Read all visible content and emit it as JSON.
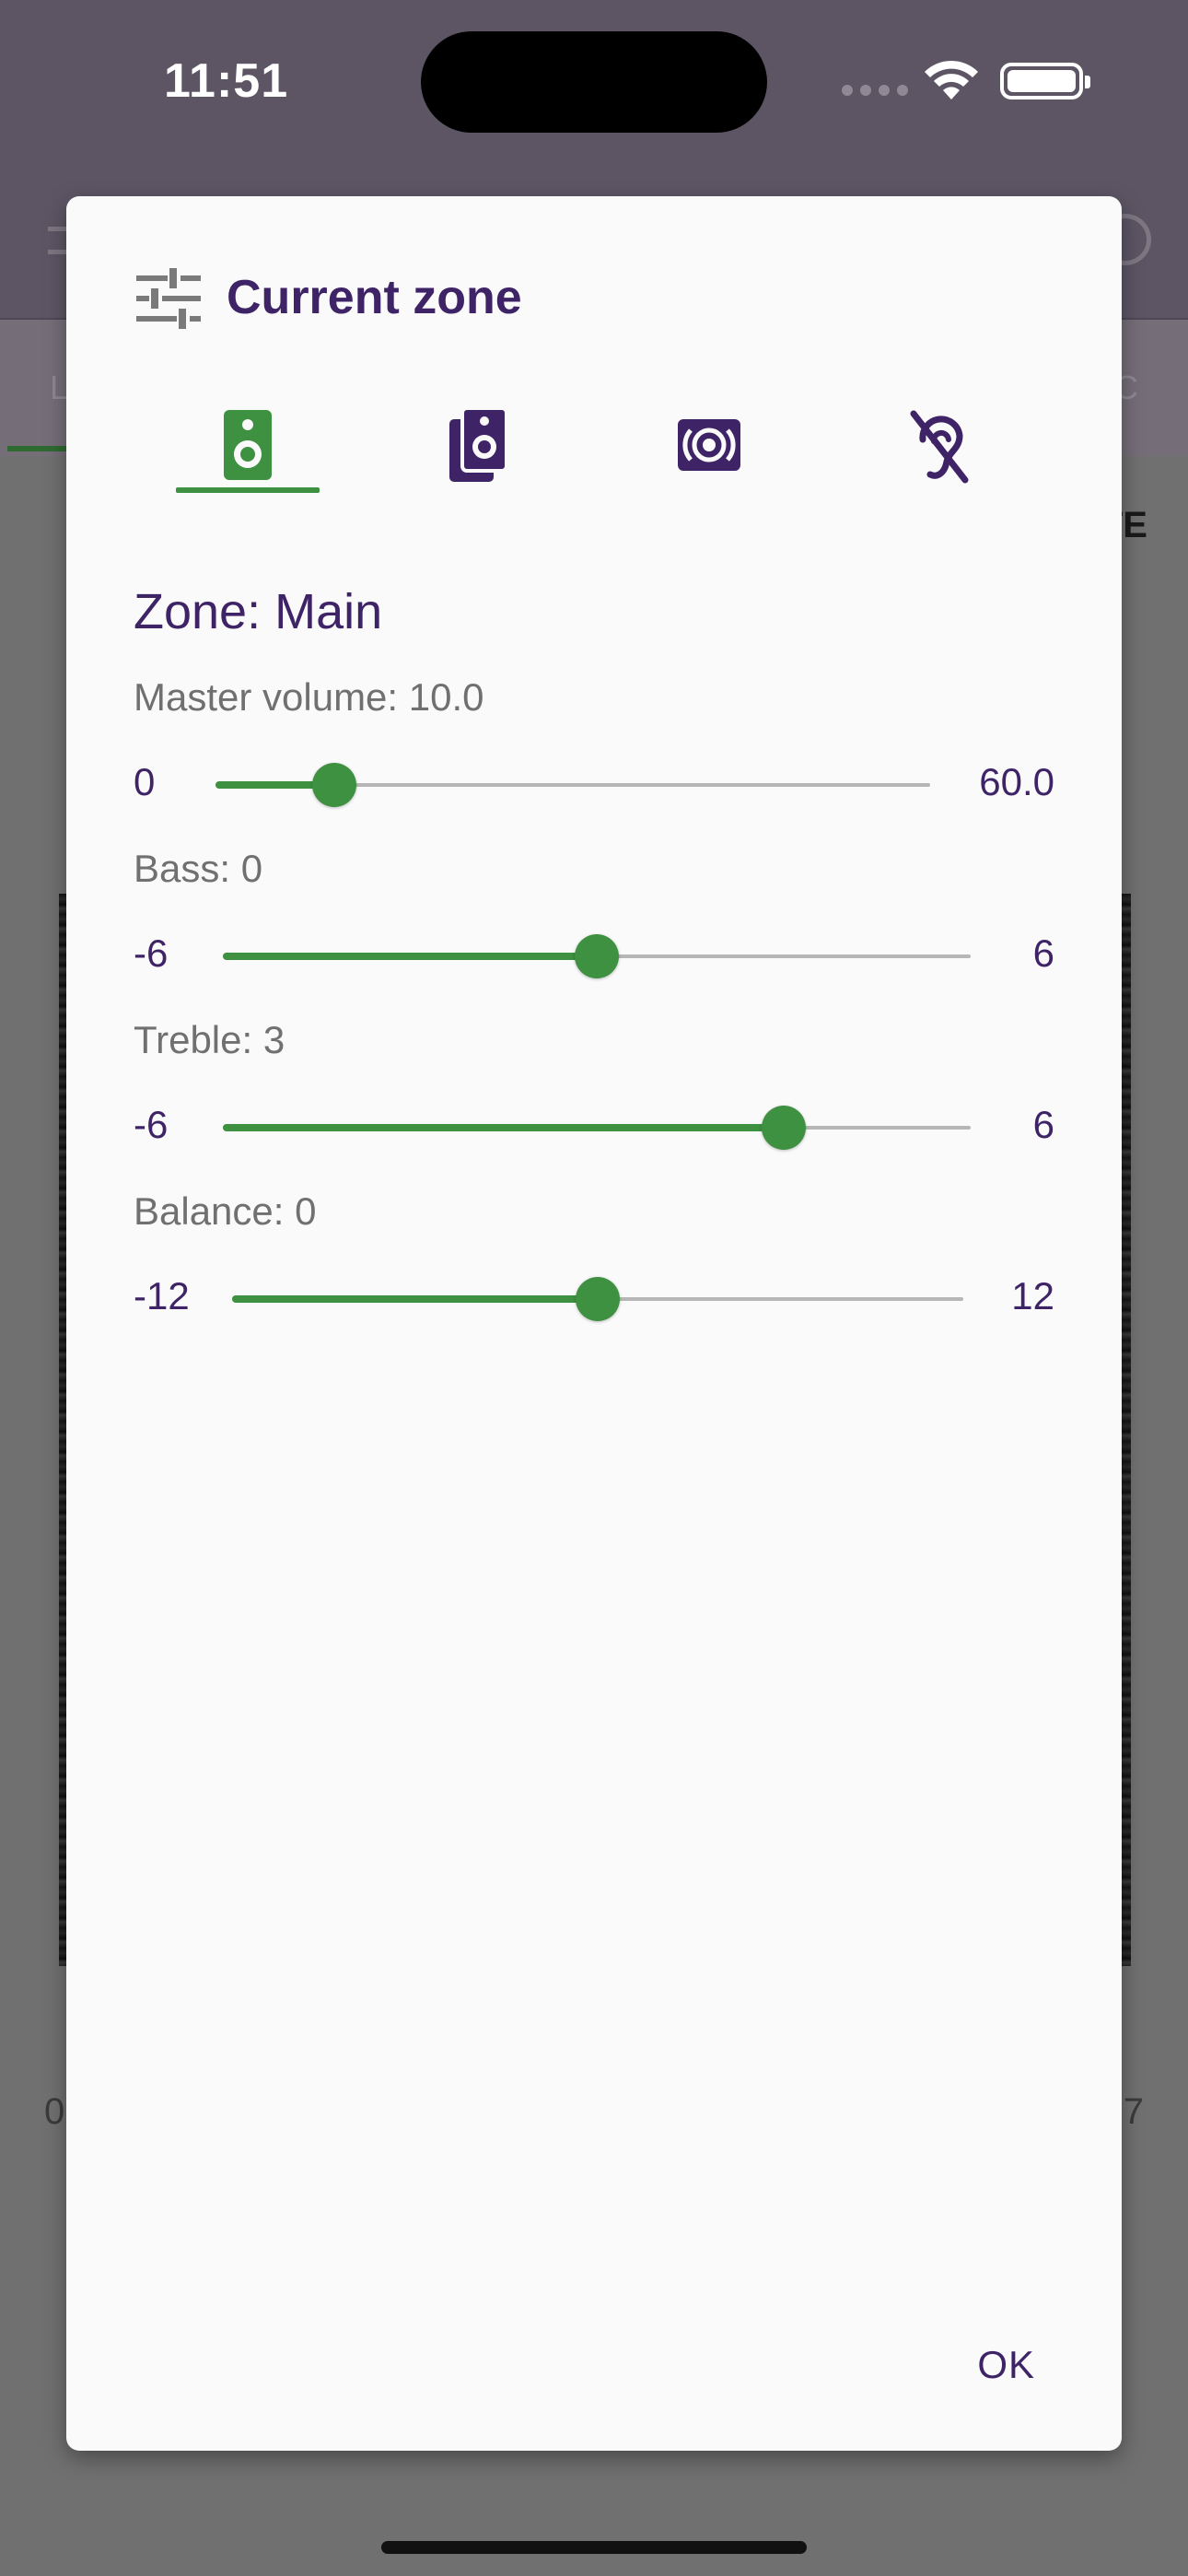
{
  "status_bar": {
    "time": "11:51"
  },
  "background": {
    "tab_left": "L",
    "tab_right": "C",
    "header_fragment": "TE",
    "num_left": "0",
    "num_right": "7"
  },
  "dialog": {
    "title": "Current zone",
    "title_icon": "tune-sliders-icon",
    "tabs": [
      {
        "icon": "speaker-icon",
        "selected": true
      },
      {
        "icon": "speakers-stack-icon",
        "selected": false
      },
      {
        "icon": "surround-sound-icon",
        "selected": false
      },
      {
        "icon": "hearing-disabled-icon",
        "selected": false
      }
    ],
    "zone_heading": "Zone: Main",
    "sliders": [
      {
        "label": "Master volume: 10.0",
        "min": "0",
        "max": "60.0",
        "value": 10.0,
        "range": [
          0,
          60
        ]
      },
      {
        "label": "Bass: 0",
        "min": "-6",
        "max": "6",
        "value": 0,
        "range": [
          -6,
          6
        ]
      },
      {
        "label": "Treble: 3",
        "min": "-6",
        "max": "6",
        "value": 3,
        "range": [
          -6,
          6
        ]
      },
      {
        "label": "Balance: 0",
        "min": "-12",
        "max": "12",
        "value": 0,
        "range": [
          -12,
          12
        ]
      }
    ],
    "ok_label": "OK"
  },
  "colors": {
    "accent": "#3d9140",
    "primary": "#3e2466",
    "track": "#b6b6b6"
  }
}
